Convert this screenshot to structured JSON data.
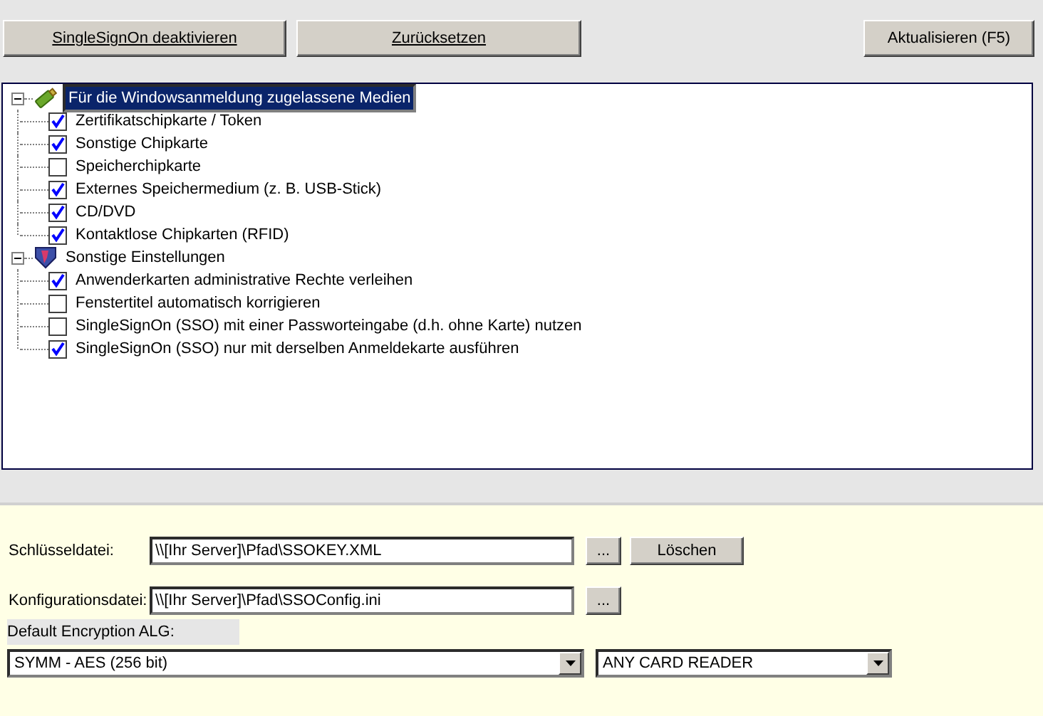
{
  "toolbar": {
    "buttons": [
      {
        "label": "SingleSignOn deaktivieren",
        "underlined": true
      },
      {
        "label": "Zurücksetzen",
        "underlined": true
      },
      {
        "label": "Aktualisieren (F5)",
        "underlined": false
      }
    ]
  },
  "tree": [
    {
      "label": "Für die Windowsanmeldung zugelassene Medien",
      "kind": "usb",
      "expanded": true,
      "selected": true,
      "children": [
        {
          "label": "Zertifikatschipkarte / Token",
          "checked": true
        },
        {
          "label": "Sonstige Chipkarte",
          "checked": true
        },
        {
          "label": "Speicherchipkarte",
          "checked": false
        },
        {
          "label": "Externes Speichermedium (z. B. USB-Stick)",
          "checked": true
        },
        {
          "label": "CD/DVD",
          "checked": true
        },
        {
          "label": "Kontaktlose Chipkarten (RFID)",
          "checked": true
        }
      ]
    },
    {
      "label": "Sonstige Einstellungen",
      "kind": "shield",
      "expanded": true,
      "selected": false,
      "children": [
        {
          "label": "Anwenderkarten administrative Rechte verleihen",
          "checked": true
        },
        {
          "label": "Fenstertitel automatisch korrigieren",
          "checked": false
        },
        {
          "label": "SingleSignOn (SSO) mit einer Passworteingabe (d.h. ohne Karte) nutzen",
          "checked": false
        },
        {
          "label": "SingleSignOn (SSO) nur mit derselben Anmeldekarte ausführen",
          "checked": true
        }
      ]
    }
  ],
  "settings": {
    "key_file": {
      "label": "Schlüsseldatei:",
      "value": "\\\\[Ihr Server]\\Pfad\\SSOKEY.XML",
      "browse": "...",
      "delete": "Löschen"
    },
    "config_file": {
      "label": "Konfigurationsdatei:",
      "value": "\\\\[Ihr Server]\\Pfad\\SSOConfig.ini",
      "browse": "..."
    },
    "encryption_label": "Default Encryption ALG:",
    "encryption": "SYMM - AES (256 bit)",
    "reader": "ANY CARD READER"
  }
}
